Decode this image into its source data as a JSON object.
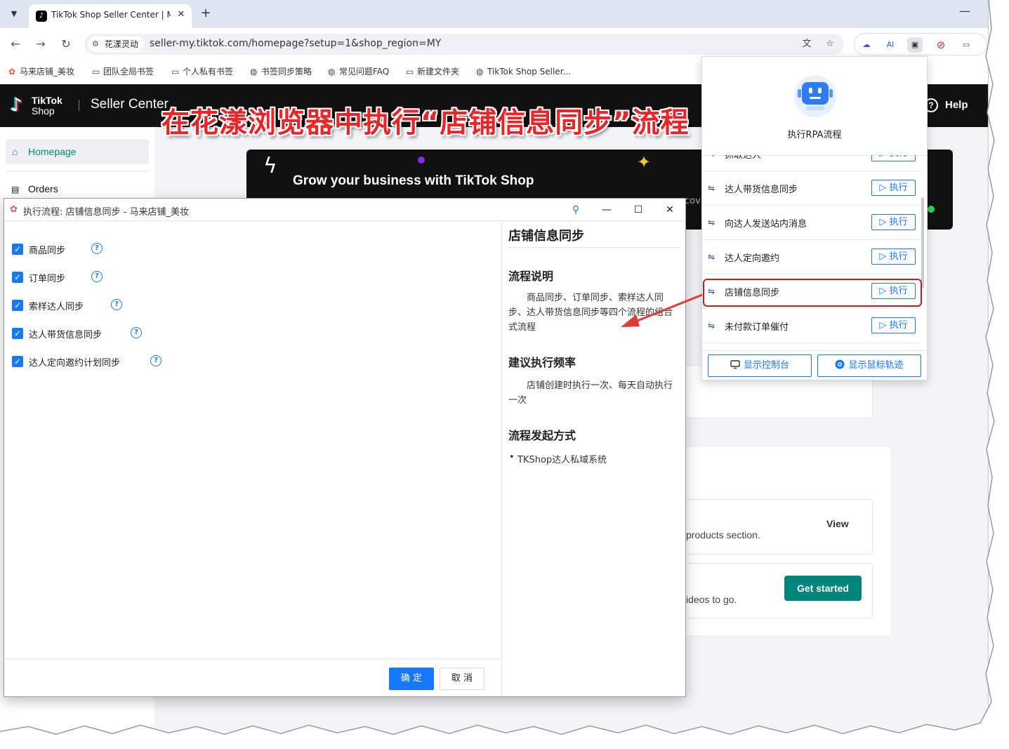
{
  "browser": {
    "tab": {
      "title": "TikTok Shop Seller Center | M",
      "favicon": "tiktok-icon",
      "close": "✕"
    },
    "new_tab": "+",
    "window_minimize": "—",
    "nav": {
      "back": "←",
      "forward": "→",
      "reload": "↻"
    },
    "site_chip": "花漾灵动",
    "url": "seller-my.tiktok.com/homepage?setup=1&shop_region=MY",
    "bookmarks": [
      {
        "label": "马来店铺_美妆",
        "icon": "huayang-logo-icon"
      },
      {
        "label": "团队全局书签",
        "icon": "folder-icon"
      },
      {
        "label": "个人私有书签",
        "icon": "folder-icon"
      },
      {
        "label": "书签同步策略",
        "icon": "globe-icon"
      },
      {
        "label": "常见问题FAQ",
        "icon": "globe-icon"
      },
      {
        "label": "新建文件夹",
        "icon": "folder-icon"
      },
      {
        "label": "TikTok Shop Seller...",
        "icon": "globe-icon"
      }
    ]
  },
  "tiktok": {
    "logo_line1": "TikTok",
    "logo_line2": "Shop",
    "seller_center": "Seller Center",
    "help": "Help",
    "sidebar": {
      "homepage": "Homepage",
      "orders": "Orders"
    },
    "banner": {
      "title": "Grow your business with TikTok Shop",
      "partial_text": "cov"
    },
    "card_products": {
      "text": "products section.",
      "action": "View"
    },
    "card_videos": {
      "text": "ideos to go.",
      "action": "Get started"
    },
    "accent_color": "#00857a"
  },
  "overlay_title": "在花漾浏览器中执行“店铺信息同步”流程",
  "rpa_panel": {
    "title": "执行RPA流程",
    "items": [
      {
        "name": "抓取达人",
        "run": "执行"
      },
      {
        "name": "达人带货信息同步",
        "run": "执行"
      },
      {
        "name": "向达人发送站内消息",
        "run": "执行"
      },
      {
        "name": "达人定向邀约",
        "run": "执行"
      },
      {
        "name": "店铺信息同步",
        "run": "执行",
        "highlighted": true
      },
      {
        "name": "未付款订单催付",
        "run": "执行"
      }
    ],
    "show_console": "显示控制台",
    "show_mouse_track": "显示鼠标轨迹",
    "accent_color": "#1677ff",
    "highlight_color": "#d0191f"
  },
  "dialog": {
    "title": "执行流程: 店铺信息同步 - 马来店铺_美妆",
    "options": [
      {
        "label": "商品同步",
        "checked": true
      },
      {
        "label": "订单同步",
        "checked": true
      },
      {
        "label": "索样达人同步",
        "checked": true
      },
      {
        "label": "达人带货信息同步",
        "checked": true
      },
      {
        "label": "达人定向邀约计划同步",
        "checked": true
      }
    ],
    "ok": "确 定",
    "cancel": "取 消",
    "info": {
      "heading": "店铺信息同步",
      "desc_heading": "流程说明",
      "desc": "商品同步、订单同步、索样达人同步、达人带货信息同步等四个流程的组合式流程",
      "freq_heading": "建议执行频率",
      "freq": "店铺创建时执行一次、每天自动执行一次",
      "trigger_heading": "流程发起方式",
      "triggers": [
        "TKShop达人私域系统"
      ]
    }
  }
}
